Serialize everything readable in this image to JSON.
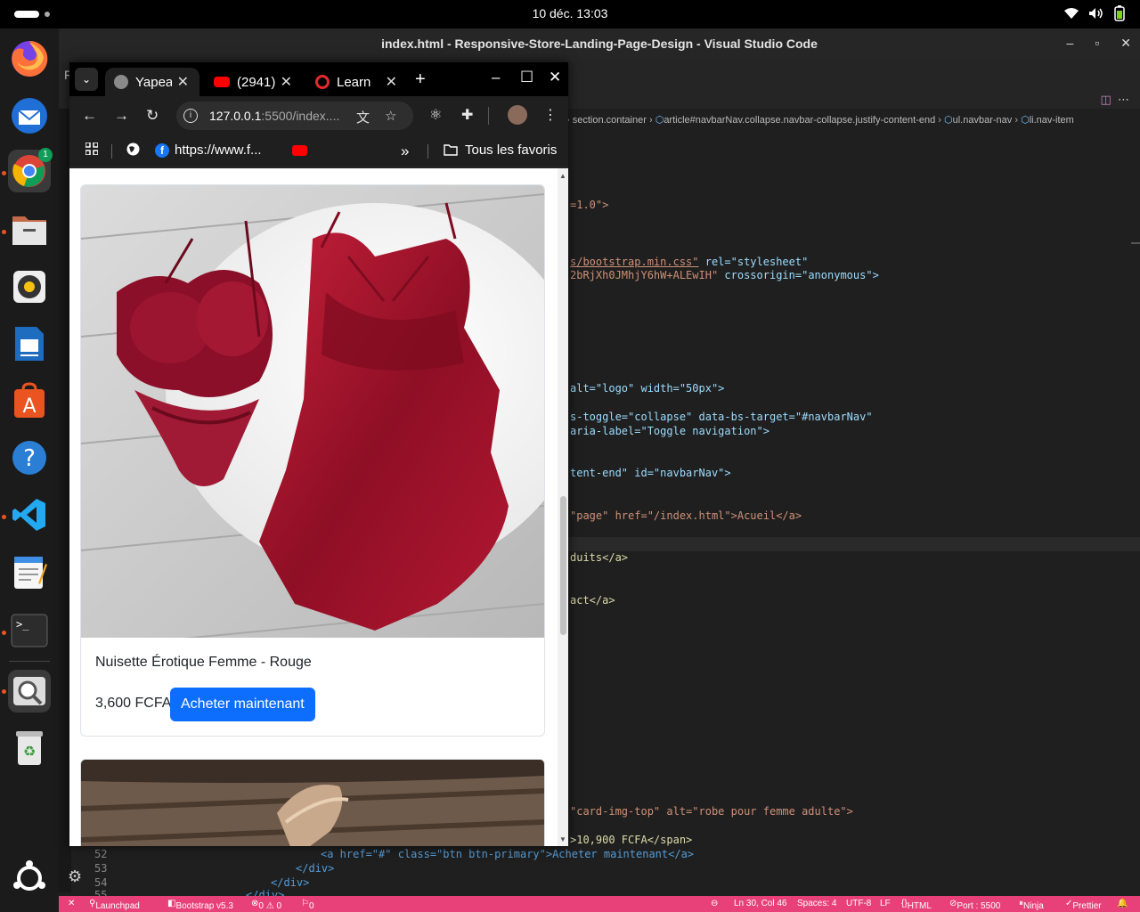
{
  "system": {
    "clock": "10 déc.  13:03"
  },
  "vscode": {
    "title": "index.html - Responsive-Store-Landing-Page-Design - Visual Studio Code",
    "breadcrumb": [
      "section.container",
      "article#navbarNav.collapse.navbar-collapse.justify-content-end",
      "ul.navbar-nav",
      "li.nav-item"
    ],
    "tab_letter": "F",
    "code_lines": [
      {
        "pre": "",
        "a": "=1.0\">",
        "b": ""
      },
      {
        "pre": "",
        "a": "s/bootstrap.min.css\"",
        "b": " rel=\"stylesheet\""
      },
      {
        "pre": "",
        "a": "2bRjXh0JMhjY6hW+ALEwIH\"",
        "b": " crossorigin=\"anonymous\">"
      },
      {
        "pre": "",
        "a": "alt=\"logo\"",
        "b": " width=\"50px\">"
      },
      {
        "pre": "",
        "a": "s-toggle=\"collapse\"",
        "b": " data-bs-target=\"#navbarNav\""
      },
      {
        "pre": "",
        "a": "aria-label=\"Toggle navigation\">",
        "b": ""
      },
      {
        "pre": "",
        "a": "tent-end\"",
        "b": " id=\"navbarNav\">"
      },
      {
        "pre": "",
        "a": "\"page\" href=\"/index.html\">Acueil</a>",
        "b": ""
      },
      {
        "pre": "",
        "a": "duits</a>",
        "b": ""
      },
      {
        "pre": "",
        "a": "act</a>",
        "b": ""
      },
      {
        "pre": "",
        "a": "\"card-img-top\" alt=\"robe pour femme adulte\">",
        "b": ""
      },
      {
        "pre": "",
        "a": ">10,900 FCFA</span>",
        "b": ""
      }
    ],
    "bottom_lines": [
      {
        "num": "52",
        "code": "<a href=\"#\" class=\"btn btn-primary\">Acheter maintenant</a>"
      },
      {
        "num": "53",
        "code": "</div>"
      },
      {
        "num": "54",
        "code": "</div>"
      },
      {
        "num": "55",
        "code": "</div>"
      }
    ],
    "statusbar": {
      "launchpad": "Launchpad",
      "bootstrap": "Bootstrap v5.3",
      "problems": "0 ⚠ 0",
      "ports": "0",
      "position": "Ln 30, Col 46",
      "spaces": "Spaces: 4",
      "encoding": "UTF-8",
      "eol": "LF",
      "language": "HTML",
      "port": "Port : 5500",
      "ninja": "Ninja",
      "prettier": "Prettier"
    }
  },
  "chrome": {
    "tabs": [
      {
        "label": "Yapeal",
        "active": true,
        "favicon_color": "#6c6c6c"
      },
      {
        "label": "(2941)",
        "active": false,
        "favicon_color": "#ff0000"
      },
      {
        "label": "Learn",
        "active": false,
        "favicon_color": "#e22a2a"
      }
    ],
    "url_host": "127.0.0.1",
    "url_rest": ":5500/index....",
    "bookmarks": [
      {
        "label": "https://www.f..."
      }
    ],
    "all_bookmarks": "Tous les favoris",
    "extension_badge": "1"
  },
  "page": {
    "products": [
      {
        "title": "Nuisette Érotique Femme - Rouge",
        "price": "3,600 FCFA",
        "button": "Acheter maintenant",
        "image": "red-satin-lingerie"
      },
      {
        "image": "sandals-on-wood"
      }
    ]
  },
  "colors": {
    "bootstrap_primary": "#0d6efd",
    "vscode_statusbar": "#e8417a",
    "ubuntu_orange": "#e95420"
  }
}
